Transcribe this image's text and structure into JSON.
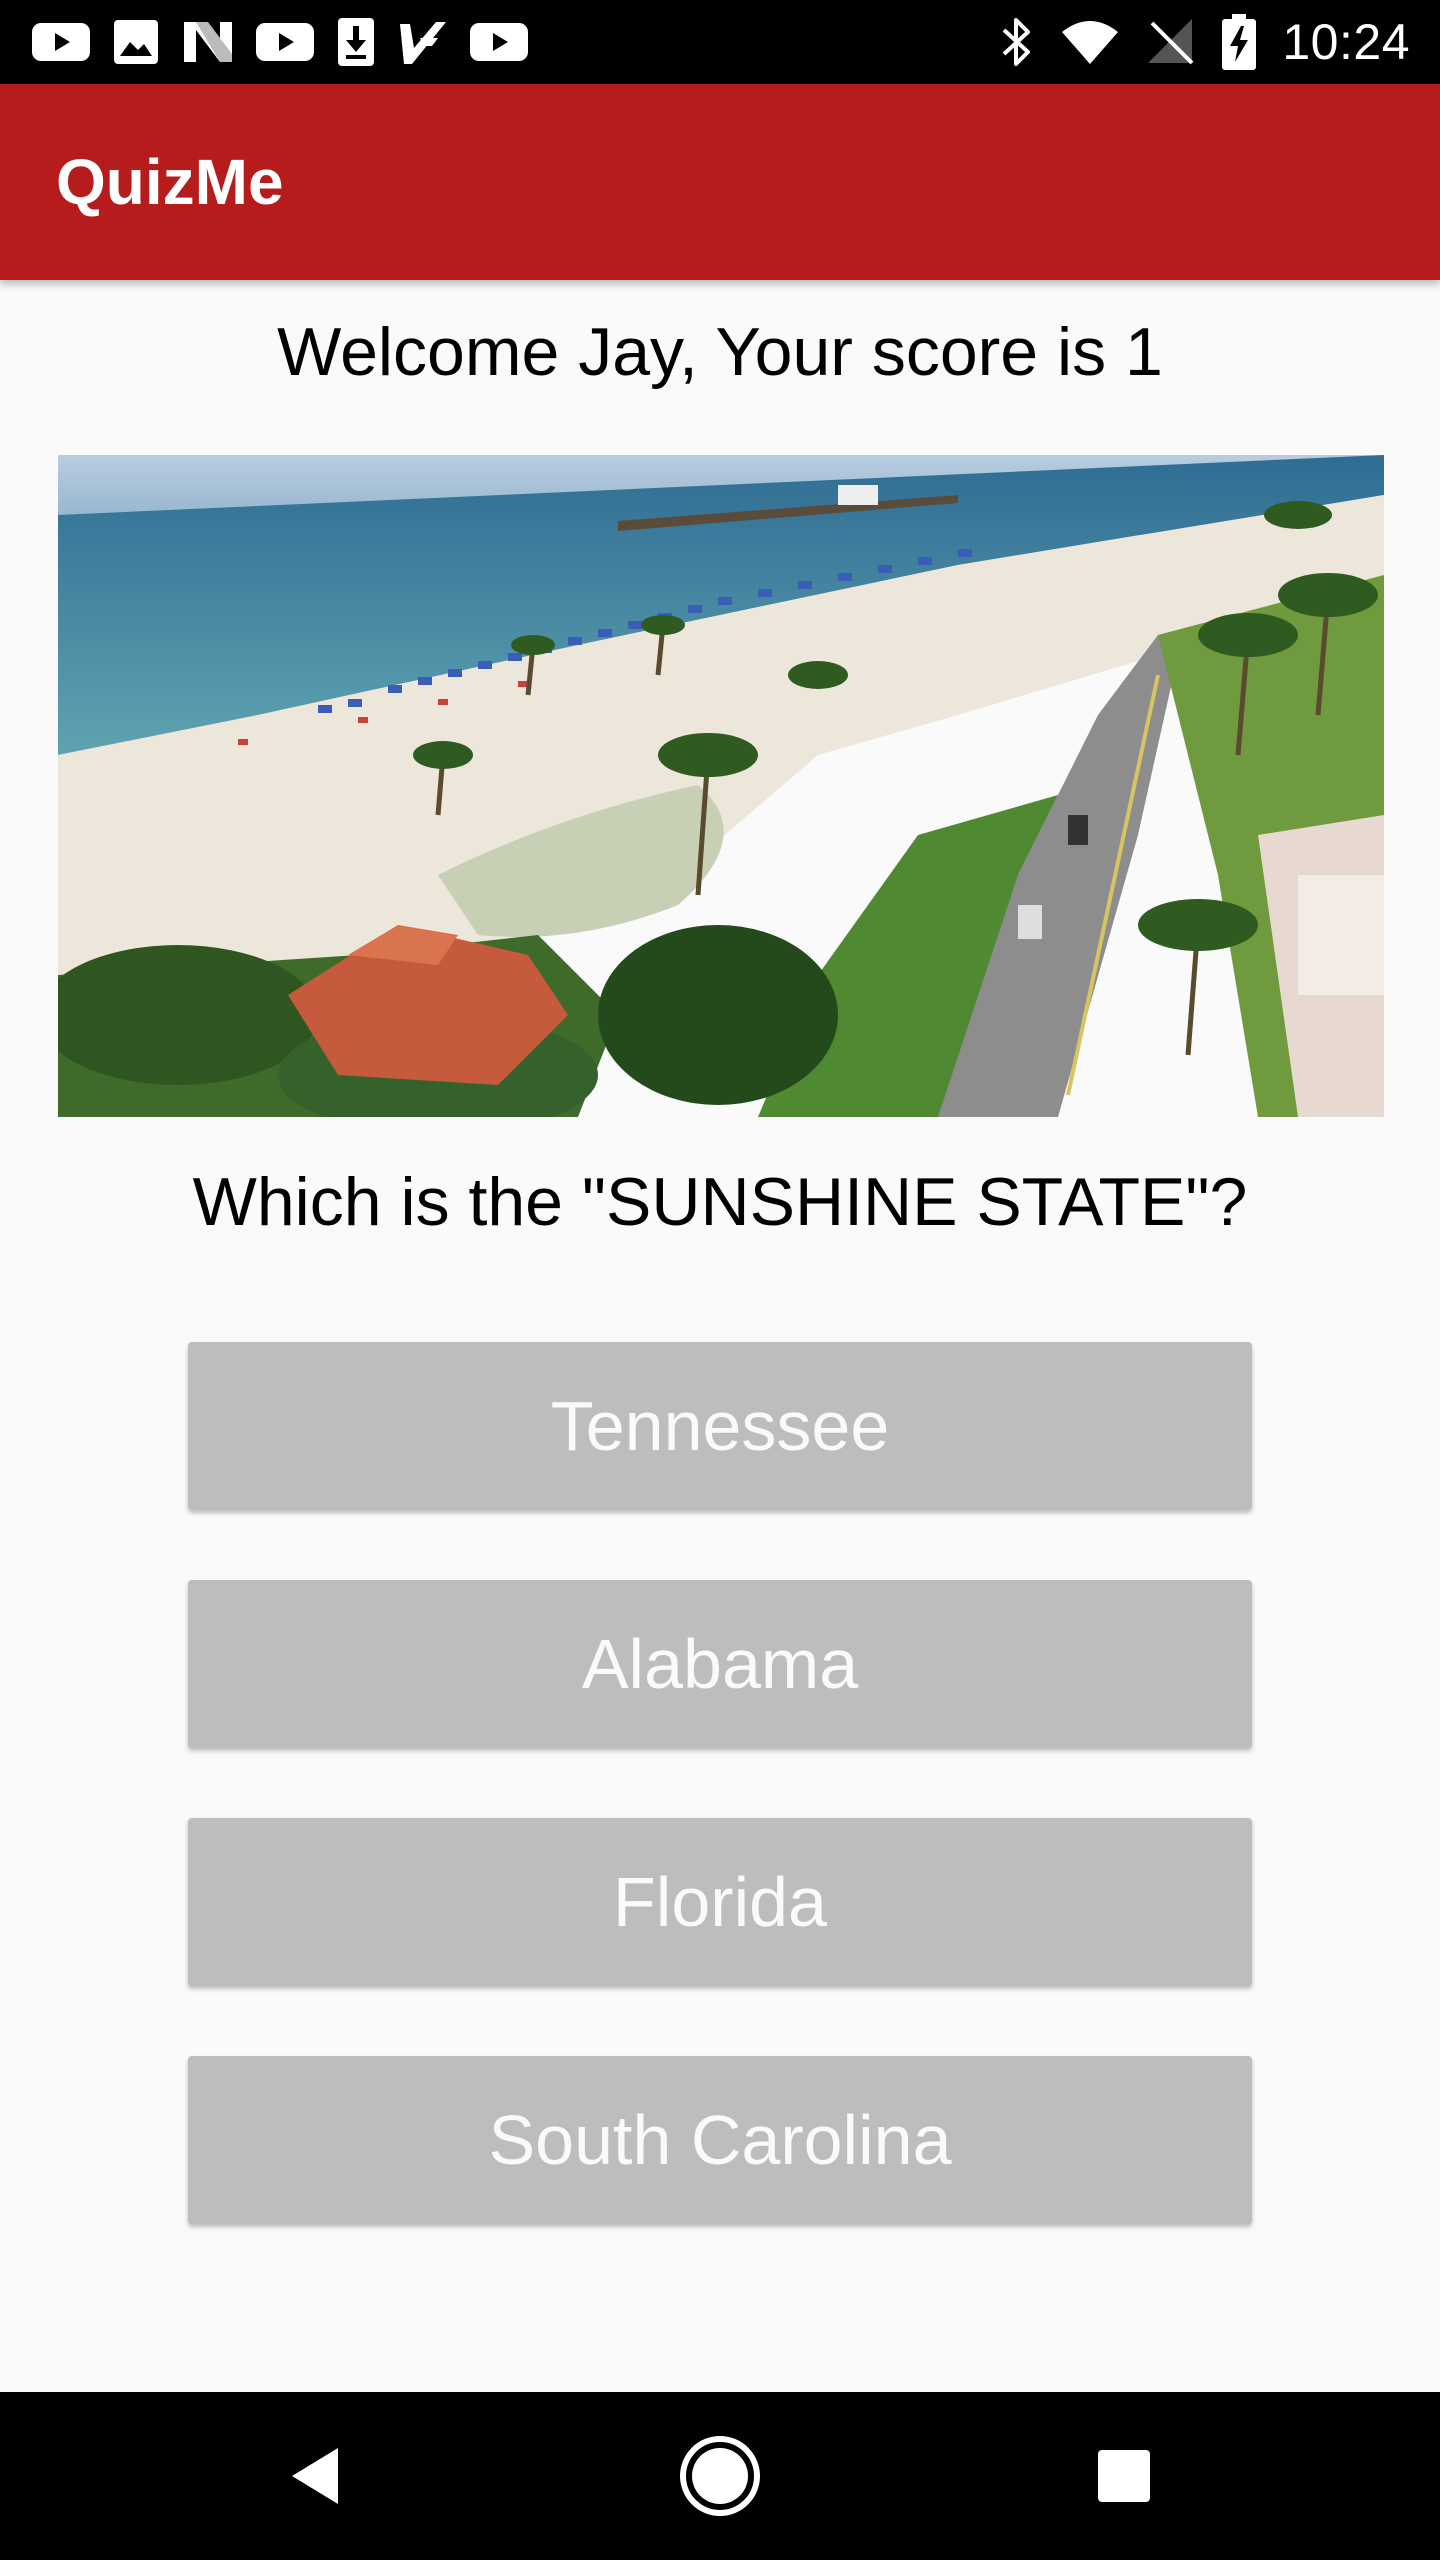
{
  "status_bar": {
    "time": "10:24",
    "notification_icons": [
      "youtube-icon",
      "image-icon",
      "n-app-icon",
      "youtube-icon",
      "download-icon",
      "check-app-icon",
      "youtube-icon"
    ],
    "system_icons": [
      "bluetooth-icon",
      "wifi-icon",
      "no-signal-icon",
      "battery-charging-icon"
    ]
  },
  "app_bar": {
    "title": "QuizMe",
    "color": "#b71c1c"
  },
  "welcome": {
    "text": "Welcome Jay, Your score is 1"
  },
  "question": {
    "image": "beach-photo",
    "text": "Which is the \"SUNSHINE STATE\"?"
  },
  "answers": [
    {
      "label": "Tennessee"
    },
    {
      "label": "Alabama"
    },
    {
      "label": "Florida"
    },
    {
      "label": "South Carolina"
    }
  ],
  "nav_bar": {
    "buttons": [
      "back-icon",
      "home-icon",
      "recents-icon"
    ]
  }
}
